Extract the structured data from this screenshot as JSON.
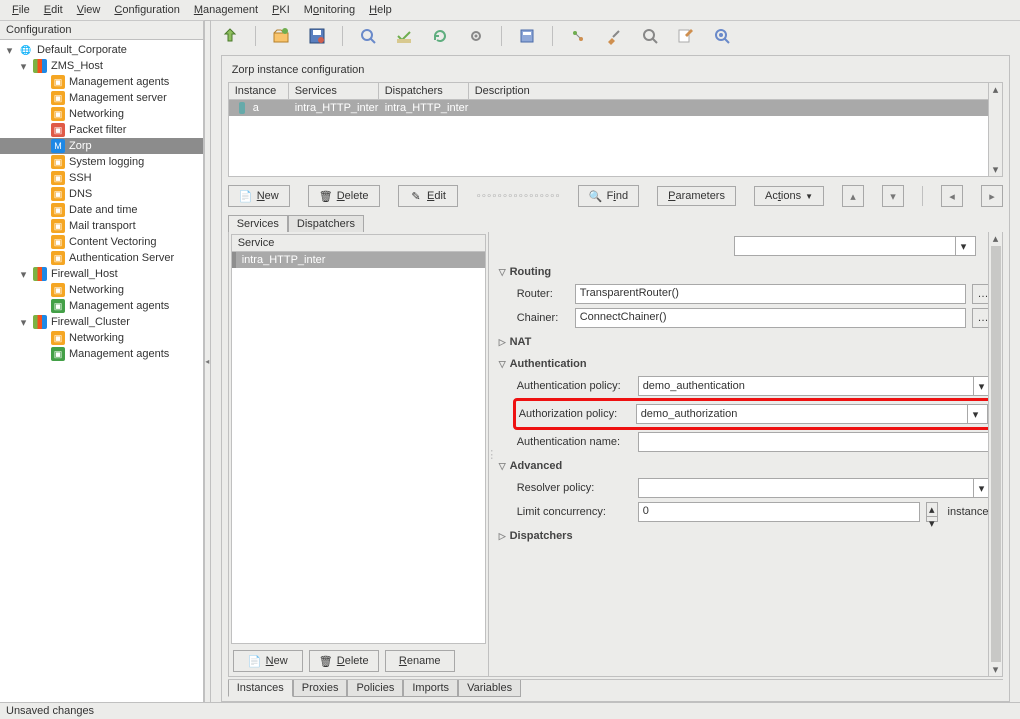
{
  "menu": {
    "file": "File",
    "edit": "Edit",
    "view": "View",
    "configuration": "Configuration",
    "management": "Management",
    "pki": "PKI",
    "monitoring": "Monitoring",
    "help": "Help"
  },
  "left": {
    "title": "Configuration",
    "root": "Default_Corporate",
    "zms": "ZMS_Host",
    "zms_children": {
      "mgmt_agents": "Management agents",
      "mgmt_server": "Management server",
      "networking": "Networking",
      "packet_filter": "Packet filter",
      "zorp": "Zorp",
      "syslog": "System logging",
      "ssh": "SSH",
      "dns": "DNS",
      "datetime": "Date and time",
      "mail": "Mail transport",
      "content_vec": "Content Vectoring",
      "auth_server": "Authentication Server"
    },
    "fw_host": "Firewall_Host",
    "fw_host_children": {
      "networking": "Networking",
      "mgmt_agents": "Management agents"
    },
    "fw_cluster": "Firewall_Cluster",
    "fw_cluster_children": {
      "networking": "Networking",
      "mgmt_agents": "Management agents"
    }
  },
  "content": {
    "title": "Zorp instance configuration",
    "grid": {
      "headers": {
        "instance": "Instance",
        "services": "Services",
        "dispatchers": "Dispatchers",
        "description": "Description"
      },
      "row": {
        "instance": "a",
        "services": "intra_HTTP_inter",
        "dispatchers": "intra_HTTP_inter",
        "description": ""
      }
    },
    "buttons": {
      "new": "New",
      "delete": "Delete",
      "edit": "Edit",
      "find": "Find",
      "parameters": "Parameters",
      "actions": "Actions"
    },
    "tabs_top": {
      "services": "Services",
      "dispatchers": "Dispatchers"
    },
    "svc_list": {
      "header": "Service",
      "item": "intra_HTTP_inter"
    },
    "svc_buttons": {
      "new": "New",
      "delete": "Delete",
      "rename": "Rename"
    },
    "sections": {
      "routing": "Routing",
      "nat": "NAT",
      "auth": "Authentication",
      "advanced": "Advanced",
      "dispatchers": "Dispatchers"
    },
    "labels": {
      "router": "Router:",
      "chainer": "Chainer:",
      "auth_policy": "Authentication policy:",
      "authz_policy": "Authorization policy:",
      "auth_name": "Authentication name:",
      "resolver": "Resolver policy:",
      "limit": "Limit concurrency:",
      "instances_suffix": "instances"
    },
    "values": {
      "router": "TransparentRouter()",
      "chainer": "ConnectChainer()",
      "auth_policy": "demo_authentication",
      "authz_policy": "demo_authorization",
      "auth_name": "",
      "resolver": "",
      "limit": "0"
    },
    "bottom_tabs": {
      "instances": "Instances",
      "proxies": "Proxies",
      "policies": "Policies",
      "imports": "Imports",
      "variables": "Variables"
    }
  },
  "statusbar": "Unsaved changes"
}
